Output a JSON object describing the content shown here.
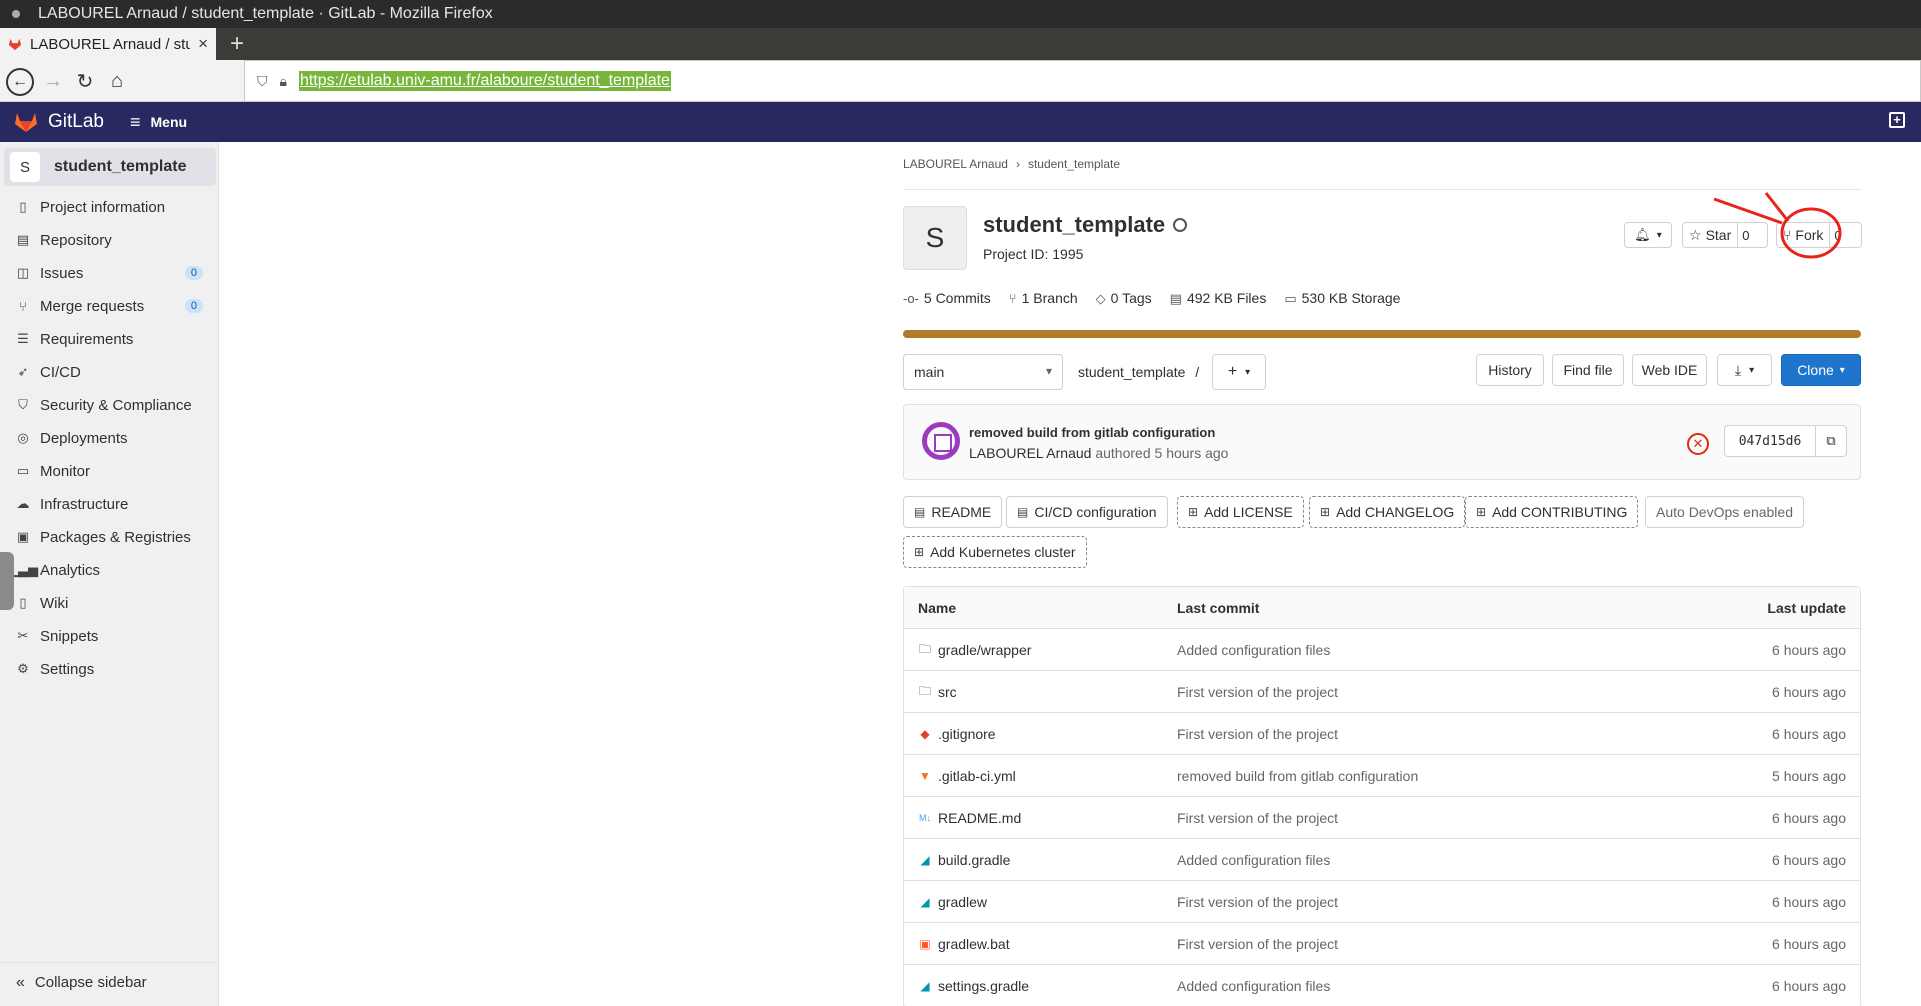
{
  "window": {
    "title": "LABOUREL Arnaud / student_template · GitLab - Mozilla Firefox"
  },
  "browser": {
    "tab_title": "LABOUREL Arnaud / student_template · GitLab",
    "url": "https://etulab.univ-amu.fr/alaboure/student_template"
  },
  "gitlab": {
    "brand": "GitLab",
    "menu_label": "Menu",
    "accent": "#292961"
  },
  "sidebar": {
    "project_initial": "S",
    "project_name": "student_template",
    "items": [
      {
        "label": "Project information",
        "icon": "info-icon"
      },
      {
        "label": "Repository",
        "icon": "doc-icon"
      },
      {
        "label": "Issues",
        "icon": "issues-icon",
        "badge": "0"
      },
      {
        "label": "Merge requests",
        "icon": "merge-icon",
        "badge": "0"
      },
      {
        "label": "Requirements",
        "icon": "requirements-icon"
      },
      {
        "label": "CI/CD",
        "icon": "rocket-icon"
      },
      {
        "label": "Security & Compliance",
        "icon": "shield-icon"
      },
      {
        "label": "Deployments",
        "icon": "deploy-icon"
      },
      {
        "label": "Monitor",
        "icon": "monitor-icon"
      },
      {
        "label": "Infrastructure",
        "icon": "cloud-icon"
      },
      {
        "label": "Packages & Registries",
        "icon": "package-icon"
      },
      {
        "label": "Analytics",
        "icon": "chart-icon"
      },
      {
        "label": "Wiki",
        "icon": "book-icon"
      },
      {
        "label": "Snippets",
        "icon": "scissors-icon"
      },
      {
        "label": "Settings",
        "icon": "gear-icon"
      }
    ],
    "collapse_label": "Collapse sidebar"
  },
  "breadcrumb": {
    "owner": "LABOUREL Arnaud",
    "project": "student_template"
  },
  "project": {
    "initial": "S",
    "title": "student_template",
    "id_label": "Project ID: 1995",
    "star_label": "Star",
    "star_count": "0",
    "fork_label": "Fork",
    "fork_count": "0"
  },
  "stats": {
    "commits": "5 Commits",
    "branches": "1 Branch",
    "tags": "0 Tags",
    "files": "492 KB Files",
    "storage": "530 KB Storage"
  },
  "repo": {
    "branch": "main",
    "path": "student_template",
    "path_sep": "/",
    "history": "History",
    "find_file": "Find file",
    "web_ide": "Web IDE",
    "clone": "Clone"
  },
  "last_commit": {
    "title": "removed build from gitlab configuration",
    "author": "LABOUREL Arnaud",
    "authored": "authored",
    "time": "5 hours ago",
    "sha": "047d15d6",
    "status_color": "#dd2b0e"
  },
  "quick_actions": {
    "readme": "README",
    "cicd": "CI/CD configuration",
    "license": "Add LICENSE",
    "changelog": "Add CHANGELOG",
    "contributing": "Add CONTRIBUTING",
    "autodevops": "Auto DevOps enabled",
    "kubernetes": "Add Kubernetes cluster"
  },
  "file_table": {
    "headers": {
      "name": "Name",
      "commit": "Last commit",
      "update": "Last update"
    },
    "rows": [
      {
        "name": "gradle/wrapper",
        "icon": "folder-icon",
        "commit": "Added configuration files",
        "update": "6 hours ago"
      },
      {
        "name": "src",
        "icon": "folder-icon",
        "commit": "First version of the project",
        "update": "6 hours ago"
      },
      {
        "name": ".gitignore",
        "icon": "git-icon",
        "commit": "First version of the project",
        "update": "6 hours ago"
      },
      {
        "name": ".gitlab-ci.yml",
        "icon": "gitlab-icon",
        "commit": "removed build from gitlab configuration",
        "update": "5 hours ago"
      },
      {
        "name": "README.md",
        "icon": "markdown-icon",
        "commit": "First version of the project",
        "update": "6 hours ago"
      },
      {
        "name": "build.gradle",
        "icon": "gradle-icon",
        "commit": "Added configuration files",
        "update": "6 hours ago"
      },
      {
        "name": "gradlew",
        "icon": "gradle-icon",
        "commit": "First version of the project",
        "update": "6 hours ago"
      },
      {
        "name": "gradlew.bat",
        "icon": "terminal-icon",
        "commit": "First version of the project",
        "update": "6 hours ago"
      },
      {
        "name": "settings.gradle",
        "icon": "gradle-icon",
        "commit": "Added configuration files",
        "update": "6 hours ago"
      }
    ]
  }
}
